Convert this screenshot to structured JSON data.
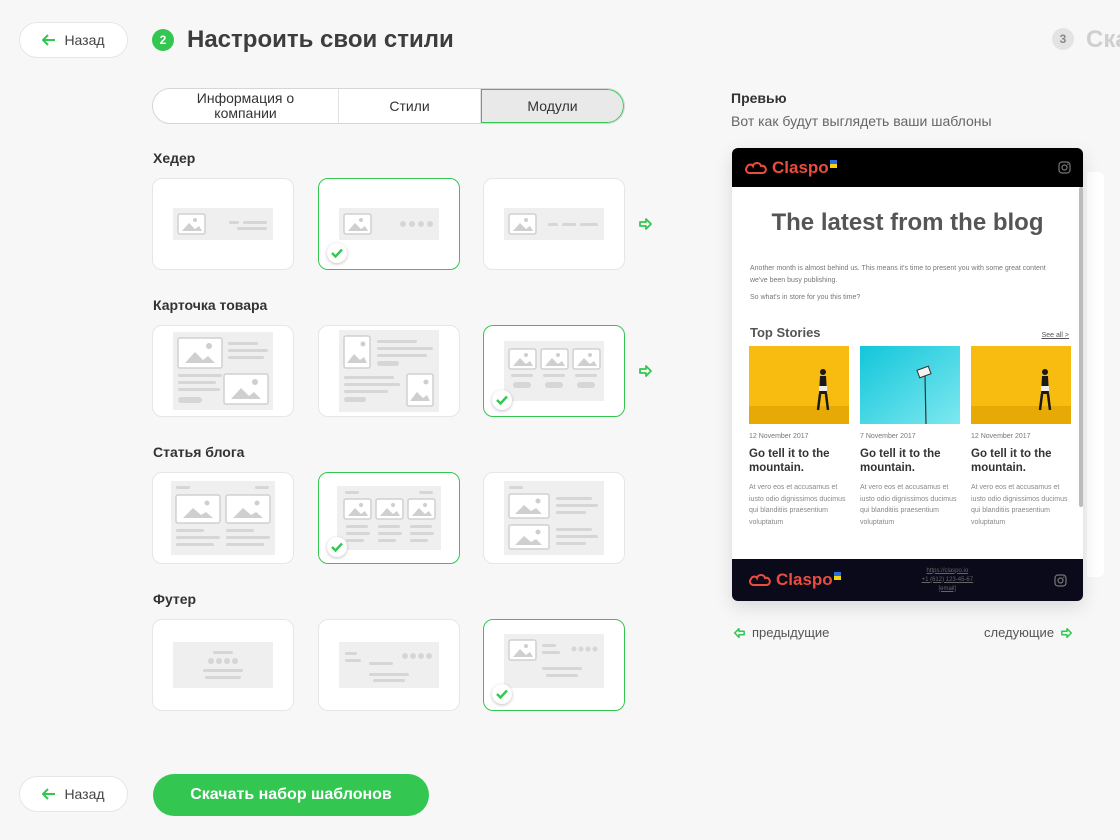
{
  "nav": {
    "back_label": "Назад",
    "step_current_num": "2",
    "step_current_title": "Настроить свои стили",
    "step_next_num": "3",
    "step_next_title": "Ска"
  },
  "tabs": [
    {
      "label": "Информация о компании",
      "active": false
    },
    {
      "label": "Стили",
      "active": false
    },
    {
      "label": "Модули",
      "active": true
    }
  ],
  "sections": {
    "header": {
      "label": "Хедер",
      "options": [
        "header-option-1",
        "header-option-2",
        "header-option-3"
      ],
      "selected": 2
    },
    "product_card": {
      "label": "Карточка товара",
      "options": [
        "product-option-1",
        "product-option-2",
        "product-option-3"
      ],
      "selected": 3
    },
    "blog_article": {
      "label": "Статья блога",
      "options": [
        "blog-option-1",
        "blog-option-2",
        "blog-option-3"
      ],
      "selected": 2
    },
    "footer": {
      "label": "Футер",
      "options": [
        "footer-option-1",
        "footer-option-2",
        "footer-option-3"
      ],
      "selected": 3
    }
  },
  "preview": {
    "title": "Превью",
    "subtitle": "Вот как будут выглядеть ваши шаблоны",
    "email": {
      "logo": "Claspo",
      "heading": "The latest from the blog",
      "intro": "Another month is almost behind us. This means it's time to present you with some great content we've been busy publishing.",
      "intro2": "So what's in store for you this time?",
      "stories_title": "Top Stories",
      "see_all": "See all >",
      "stories": [
        {
          "date": "12 November 2017",
          "title": "Go tell it to the mountain.",
          "text": "At vero eos et accusamus et iusto odio dignissimos ducimus qui blanditiis praesentium voluptatum",
          "image": "yellow-wall"
        },
        {
          "date": "7 November 2017",
          "title": "Go tell it to the mountain.",
          "text": "At vero eos et accusamus et iusto odio dignissimos ducimus qui blanditiis praesentium voluptatum",
          "image": "cyan-wall"
        },
        {
          "date": "12 November 2017",
          "title": "Go tell it to the mountain.",
          "text": "At vero eos et accusamus et iusto odio dignissimos ducimus qui blanditiis praesentium voluptatum",
          "image": "yellow-wall"
        }
      ],
      "footer_links": [
        "https://claspo.io",
        "+1 (612) 123-45-67",
        "[email]"
      ]
    },
    "prev_label": "предыдущие",
    "next_label": "следующие"
  },
  "download_label": "Скачать набор шаблонов",
  "colors": {
    "accent": "#33c752",
    "brand": "#ef4b3c"
  }
}
